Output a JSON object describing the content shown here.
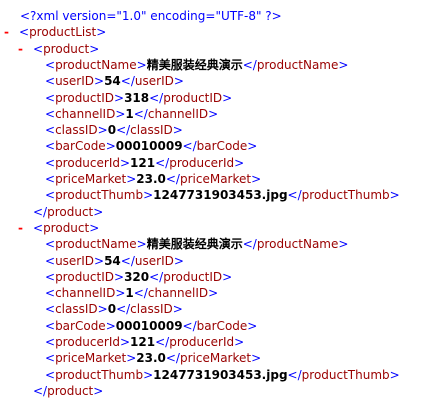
{
  "declaration": "<?xml version=\"1.0\" encoding=\"UTF-8\" ?>",
  "toggle_glyph": "-",
  "lines": [
    {
      "kind": "pi",
      "indent": 0
    },
    {
      "kind": "open",
      "indent": 0,
      "tag": "productList",
      "toggle": true
    },
    {
      "kind": "open",
      "indent": 1,
      "tag": "product",
      "toggle": true
    },
    {
      "kind": "leaf",
      "indent": 2,
      "tag": "productName",
      "value": "精美服装经典演示"
    },
    {
      "kind": "leaf",
      "indent": 2,
      "tag": "userID",
      "value": "54"
    },
    {
      "kind": "leaf",
      "indent": 2,
      "tag": "productID",
      "value": "318"
    },
    {
      "kind": "leaf",
      "indent": 2,
      "tag": "channelID",
      "value": "1"
    },
    {
      "kind": "leaf",
      "indent": 2,
      "tag": "classID",
      "value": "0"
    },
    {
      "kind": "leaf",
      "indent": 2,
      "tag": "barCode",
      "value": "00010009"
    },
    {
      "kind": "leaf",
      "indent": 2,
      "tag": "producerId",
      "value": "121"
    },
    {
      "kind": "leaf",
      "indent": 2,
      "tag": "priceMarket",
      "value": "23.0"
    },
    {
      "kind": "leaf",
      "indent": 2,
      "tag": "productThumb",
      "value": "1247731903453.jpg"
    },
    {
      "kind": "close",
      "indent": 1,
      "tag": "product"
    },
    {
      "kind": "open",
      "indent": 1,
      "tag": "product",
      "toggle": true
    },
    {
      "kind": "leaf",
      "indent": 2,
      "tag": "productName",
      "value": "精美服装经典演示"
    },
    {
      "kind": "leaf",
      "indent": 2,
      "tag": "userID",
      "value": "54"
    },
    {
      "kind": "leaf",
      "indent": 2,
      "tag": "productID",
      "value": "320"
    },
    {
      "kind": "leaf",
      "indent": 2,
      "tag": "channelID",
      "value": "1"
    },
    {
      "kind": "leaf",
      "indent": 2,
      "tag": "classID",
      "value": "0"
    },
    {
      "kind": "leaf",
      "indent": 2,
      "tag": "barCode",
      "value": "00010009"
    },
    {
      "kind": "leaf",
      "indent": 2,
      "tag": "producerId",
      "value": "121"
    },
    {
      "kind": "leaf",
      "indent": 2,
      "tag": "priceMarket",
      "value": "23.0"
    },
    {
      "kind": "leaf",
      "indent": 2,
      "tag": "productThumb",
      "value": "1247731903453.jpg"
    },
    {
      "kind": "close",
      "indent": 1,
      "tag": "product"
    }
  ],
  "colors": {
    "tag": "#990000",
    "bracket": "#0000ff",
    "toggle": "#ff0000",
    "value": "#000000",
    "background": "#ffffff"
  }
}
